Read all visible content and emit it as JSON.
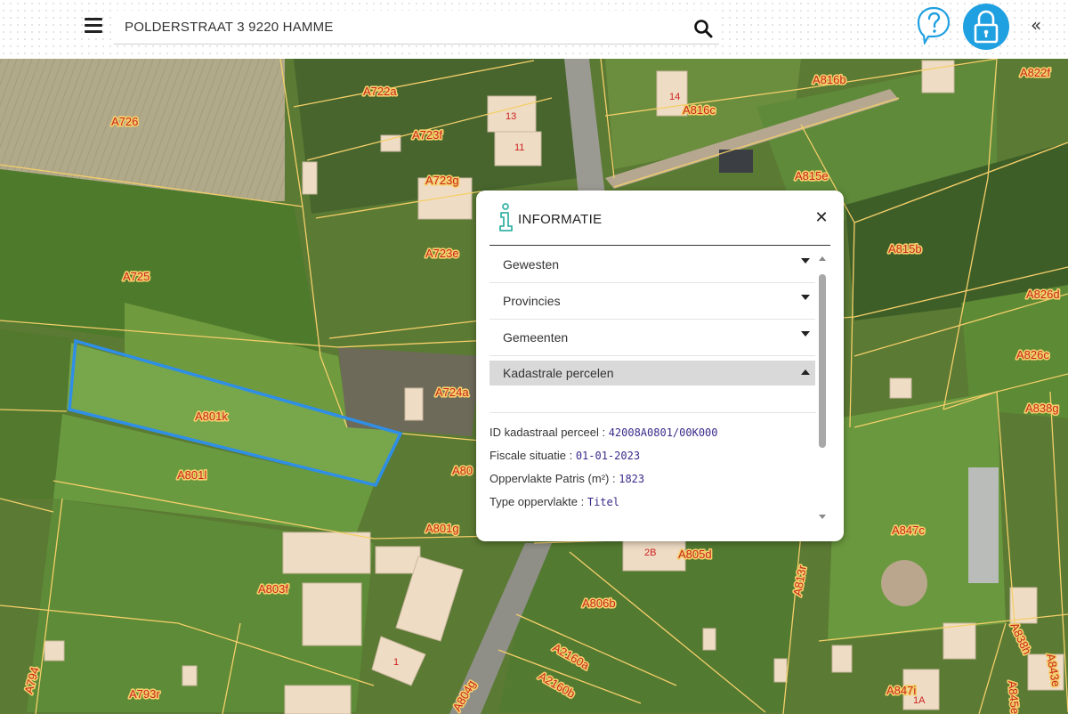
{
  "search": {
    "value": "POLDERSTRAAT 3 9220 HAMME"
  },
  "icons": {
    "menu": "hamburger-icon",
    "search": "search-icon",
    "help": "help-question-icon",
    "lock": "lock-icon",
    "collapse": "double-chevron-left-icon",
    "info": "info-icon",
    "close": "close-icon"
  },
  "colors": {
    "accent": "#1fa0e0",
    "selected_parcel": "#2f8fe6",
    "parcel_label": "#c9261e",
    "parcel_line": "#f4cf6a"
  },
  "topbar": {
    "collapse_glyph": "«"
  },
  "panel": {
    "title": "INFORMATIE",
    "close_glyph": "✕",
    "sections": [
      {
        "label": "Gewesten",
        "open": false
      },
      {
        "label": "Provincies",
        "open": false
      },
      {
        "label": "Gemeenten",
        "open": false
      },
      {
        "label": "Kadastrale percelen",
        "open": true
      }
    ],
    "details": [
      {
        "label": "ID kadastraal perceel",
        "value": "42008A0801/00K000"
      },
      {
        "label": "Fiscale situatie",
        "value": "01-01-2023"
      },
      {
        "label": "Oppervlakte Patris (m²)",
        "value": "1823"
      },
      {
        "label": "Type oppervlakte",
        "value": "Titel"
      }
    ]
  },
  "map": {
    "parcels": [
      "A726",
      "A722a",
      "A723f",
      "A723g",
      "A723e",
      "A725",
      "A724a",
      "A801k",
      "A801l",
      "A80",
      "A801g",
      "A803f",
      "A816b",
      "A816c",
      "A822f",
      "A815e",
      "A815b",
      "A826d",
      "A826c",
      "A838g",
      "A847c",
      "A806b",
      "A805d",
      "A813r",
      "A2160a",
      "A2160b",
      "A793r",
      "A794",
      "A804g",
      "A838h",
      "A847i",
      "A843e",
      "A845e"
    ],
    "house_numbers": [
      "13",
      "11",
      "14",
      "2B",
      "1",
      "1A"
    ]
  }
}
